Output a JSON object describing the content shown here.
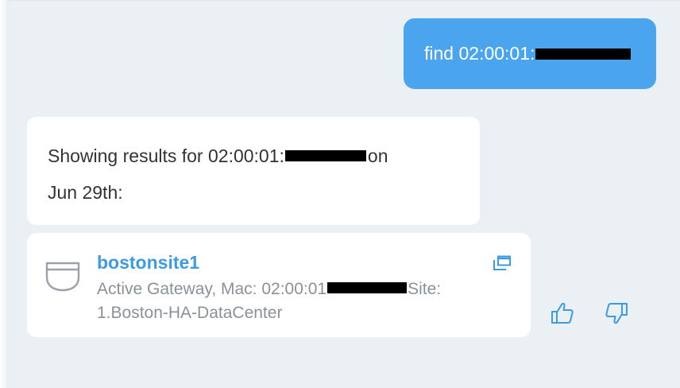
{
  "user_message": {
    "text_prefix": "find 02:00:01:"
  },
  "bot_message": {
    "text_prefix": "Showing results for 02:00:01:",
    "text_suffix": "on",
    "text_line2": "Jun 29th:"
  },
  "result": {
    "title": "bostonsite1",
    "desc_prefix": "Active Gateway, Mac: 02:00:01",
    "desc_suffix": "Site:",
    "desc_line2": "1.Boston-HA-DataCenter",
    "icon": "gateway-device-icon",
    "open_icon": "open-in-new-window-icon"
  },
  "feedback": {
    "thumbs_up_icon": "thumbs-up-icon",
    "thumbs_down_icon": "thumbs-down-icon"
  },
  "colors": {
    "user_bubble": "#4ba5ee",
    "chat_background": "#ebf0f5",
    "link": "#3d9be4",
    "secondary_text": "#8b9198",
    "icon_accent": "#3d9be4"
  }
}
